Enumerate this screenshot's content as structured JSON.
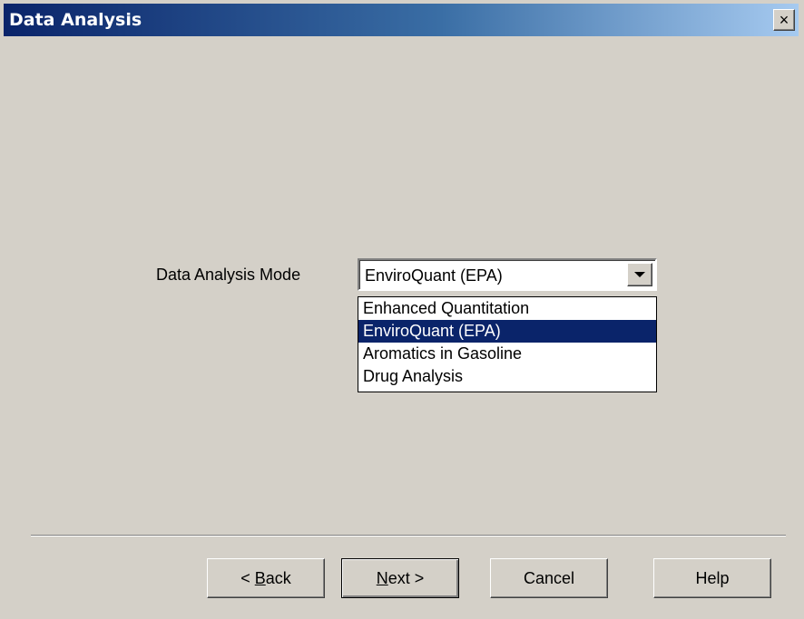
{
  "window": {
    "title": "Data Analysis",
    "close_glyph": "×"
  },
  "form": {
    "mode_label": "Data Analysis Mode",
    "mode_value": "EnviroQuant (EPA)",
    "options": [
      "Enhanced Quantitation",
      "EnviroQuant (EPA)",
      "Aromatics in Gasoline",
      "Drug Analysis"
    ],
    "selected_index": 1
  },
  "buttons": {
    "back_prefix": "< ",
    "back_accel": "B",
    "back_rest": "ack",
    "next_accel": "N",
    "next_rest": "ext >",
    "cancel": "Cancel",
    "help": "Help"
  },
  "colors": {
    "selection": "#0a246a",
    "dialog_face": "#d4d0c8"
  }
}
